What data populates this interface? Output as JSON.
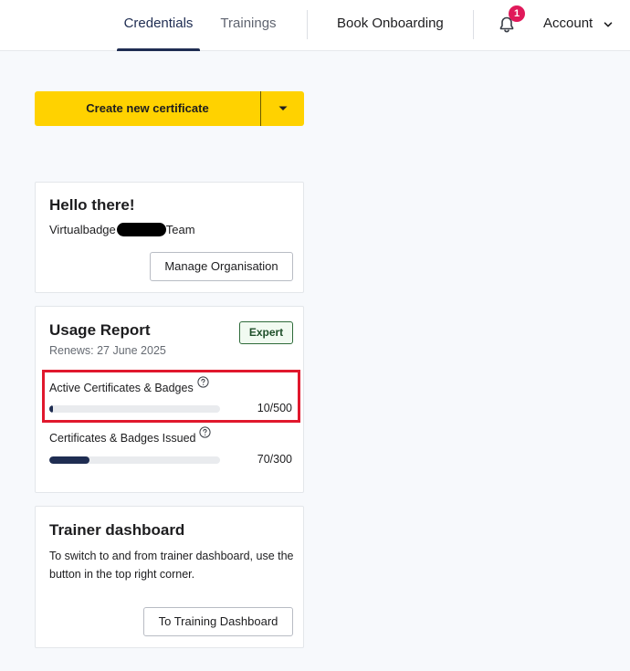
{
  "nav": {
    "tabs": [
      {
        "label": "Credentials",
        "active": true
      },
      {
        "label": "Trainings",
        "active": false
      }
    ],
    "book_onboarding": "Book Onboarding",
    "notification_count": "1",
    "account_label": "Account",
    "icons": {
      "bell": "bell-icon",
      "account_dropdown": "chevron-down-icon"
    }
  },
  "create_button": {
    "label": "Create new certificate",
    "dropdown_icon": "caret-down-icon",
    "color": "#ffd200"
  },
  "hello_card": {
    "title": "Hello there!",
    "team_prefix": "Virtualbadge",
    "team_suffix": "Team",
    "manage_button": "Manage Organisation"
  },
  "usage_card": {
    "title": "Usage Report",
    "renews": "Renews: 27 June 2025",
    "tier": "Expert",
    "metrics": [
      {
        "label": "Active Certificates & Badges",
        "value": "10/500",
        "used": 10,
        "limit": 500,
        "highlighted": true
      },
      {
        "label": "Certificates & Badges Issued",
        "value": "70/300",
        "used": 70,
        "limit": 300,
        "highlighted": false
      }
    ],
    "help_icon": "help-circle-icon",
    "bar_color": "#1f2d52",
    "highlight_color": "#e0182d"
  },
  "trainer_card": {
    "title": "Trainer dashboard",
    "description": "To switch to and from trainer dashboard, use the button in the top right corner.",
    "button": "To Training Dashboard"
  }
}
